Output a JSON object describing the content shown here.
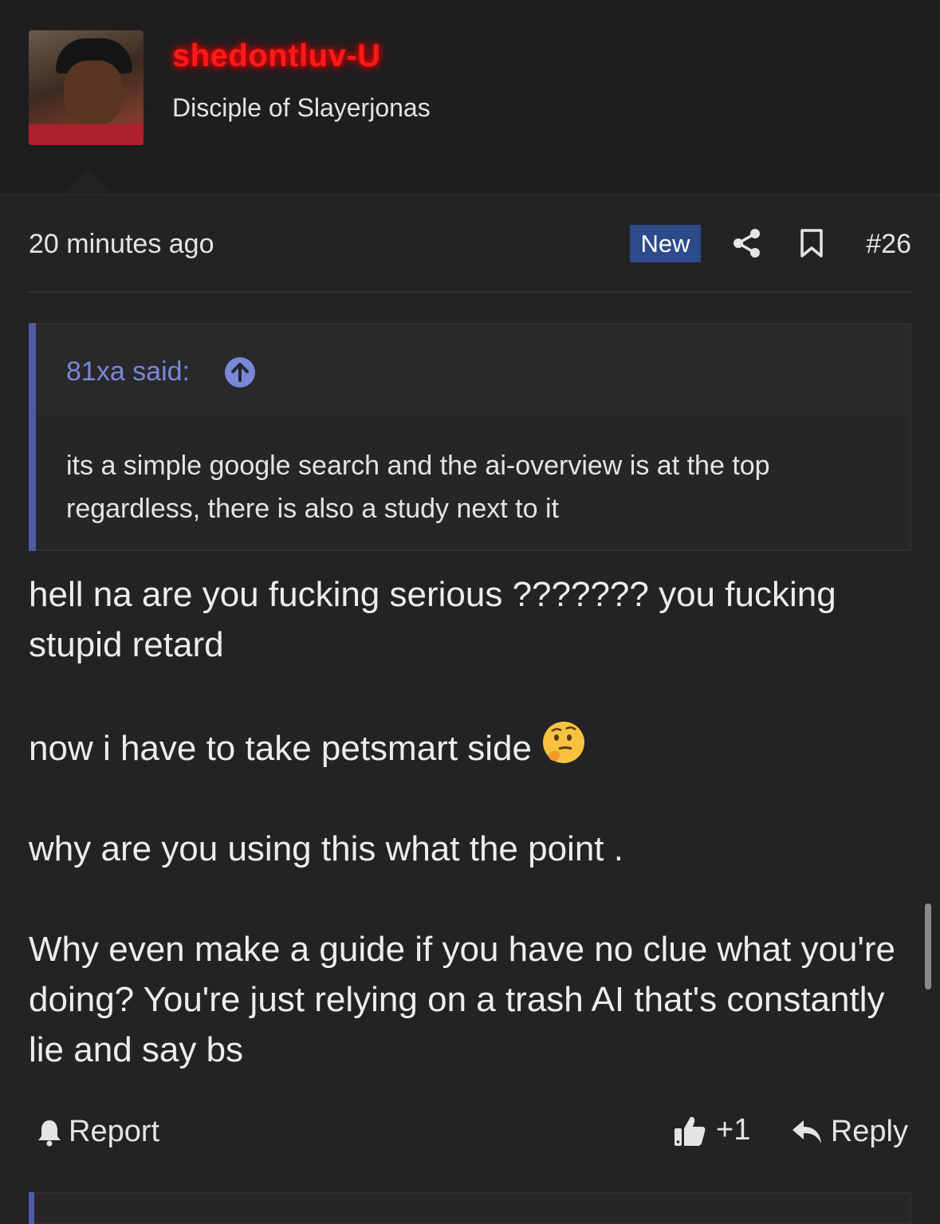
{
  "user": {
    "name": "shedontluv-U",
    "title": "Disciple of Slayerjonas",
    "name_color": "#ff1a1a"
  },
  "meta": {
    "timestamp": "20 minutes ago",
    "badge": "New",
    "post_number": "#26",
    "icons": [
      "share-icon",
      "bookmark-icon"
    ]
  },
  "quote": {
    "author": "81xa said:",
    "text": "its a simple google search and the ai-overview is at the top regardless, there is also a study next to it",
    "accent": "#4f5aa8"
  },
  "post": {
    "paragraphs": [
      "hell na are you fucking serious ??????? you fucking stupid retard",
      "now i have to take petsmart side",
      "why are you using this what the point .",
      "Why even make a guide if you have no clue what you're doing? You're just relying on a trash AI that's constantly lie and say bs"
    ],
    "emoji": "thinking-face-icon"
  },
  "actions": {
    "report": "Report",
    "reactions": "+1",
    "reply": "Reply"
  }
}
